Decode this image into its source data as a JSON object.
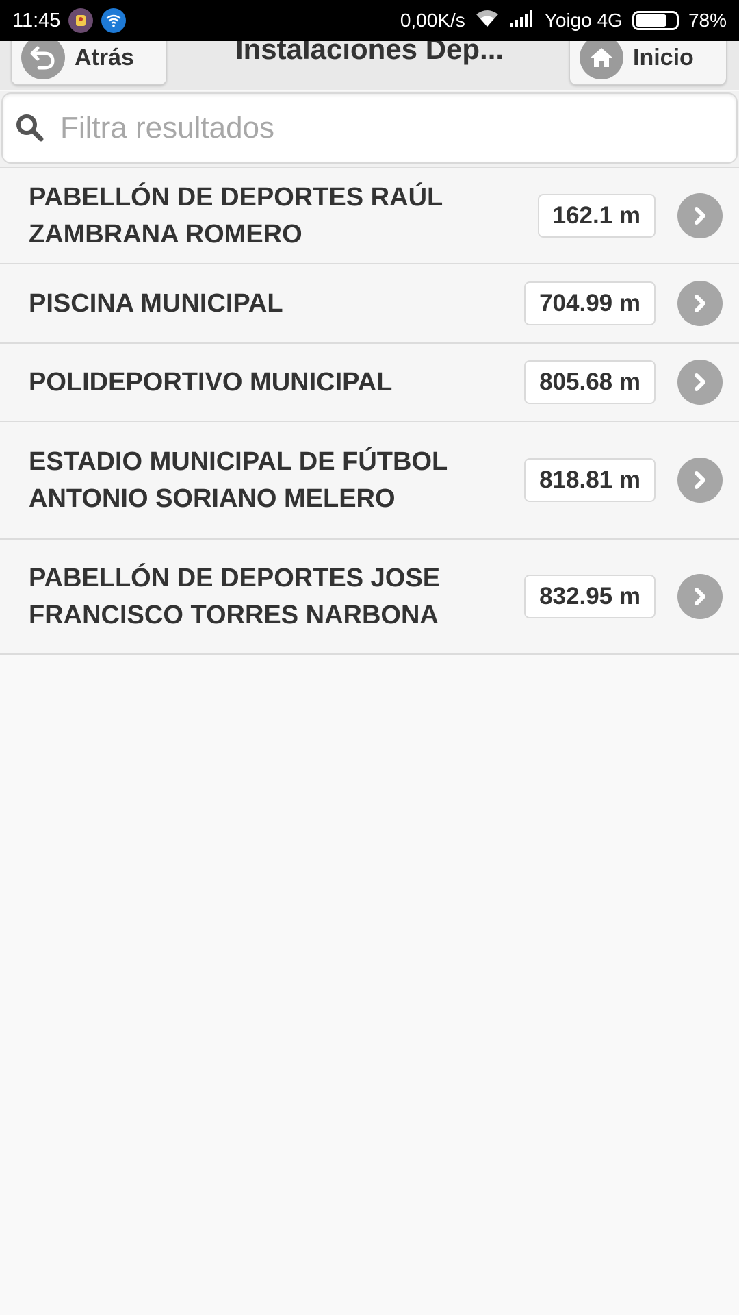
{
  "status_bar": {
    "time": "11:45",
    "speed": "0,00K/s",
    "carrier": "Yoigo 4G",
    "battery": "78%",
    "battery_level": 0.78
  },
  "header": {
    "back_label": "Atrás",
    "title": "Instalaciones Dep...",
    "home_label": "Inicio"
  },
  "search": {
    "placeholder": "Filtra resultados"
  },
  "facilities": [
    {
      "name": "PABELLÓN DE DEPORTES RAÚL ZAMBRANA ROMERO",
      "distance": "162.1 m"
    },
    {
      "name": "PISCINA MUNICIPAL",
      "distance": "704.99 m"
    },
    {
      "name": "POLIDEPORTIVO MUNICIPAL",
      "distance": "805.68 m"
    },
    {
      "name": "ESTADIO MUNICIPAL DE FÚTBOL ANTONIO SORIANO MELERO",
      "distance": "818.81 m"
    },
    {
      "name": "PABELLÓN DE DEPORTES JOSE FRANCISCO TORRES NARBONA",
      "distance": "832.95 m"
    }
  ],
  "colors": {
    "status_bar_bg": "#000000",
    "header_bg": "#e9e9e9",
    "page_bg": "#f9f9f9",
    "arrow_circle": "#a6a6a6"
  },
  "icons": {
    "back": "back-arrow-icon",
    "home": "home-icon",
    "search": "search-icon",
    "row_arrow": "chevron-right-icon"
  }
}
